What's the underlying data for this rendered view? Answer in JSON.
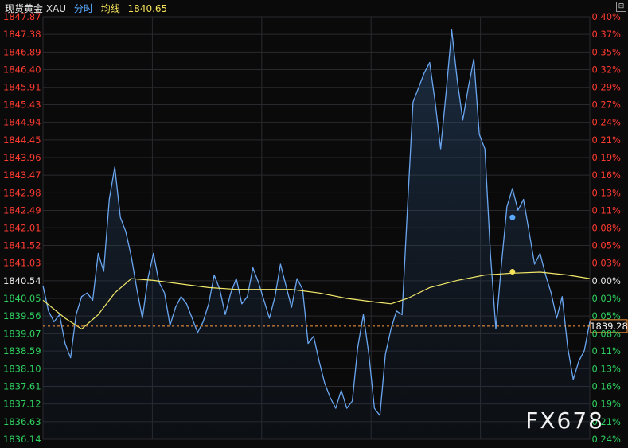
{
  "header": {
    "title": "现货黄金 XAU",
    "tab": "分时",
    "ma_label": "均线",
    "ma_value": "1840.65"
  },
  "corner_glyph": "⊟",
  "watermark": "FX678",
  "colors": {
    "up": "#ff3b30",
    "down": "#2fd05f",
    "neutral": "#e6e6e6",
    "price_line": "#6aa6f0",
    "avg_line": "#f2e86a",
    "grid": "#2a2a2e",
    "current_line": "#ff9a3c",
    "current_box_border": "#ff9a3c",
    "blue_dot": "#5aa9ff",
    "yellow_dot": "#f5e25a"
  },
  "chart_data": {
    "type": "line",
    "title": "",
    "xlabel": "",
    "ylabel": "",
    "ylim": [
      1836.14,
      1847.87
    ],
    "reference_price": 1840.54,
    "current_price": 1839.28,
    "current_price_label": "1839.28",
    "y_ticks": [
      {
        "price": "1847.87",
        "pct": "0.40%",
        "dir": "up"
      },
      {
        "price": "1847.38",
        "pct": "0.37%",
        "dir": "up"
      },
      {
        "price": "1846.89",
        "pct": "0.35%",
        "dir": "up"
      },
      {
        "price": "1846.40",
        "pct": "0.32%",
        "dir": "up"
      },
      {
        "price": "1845.91",
        "pct": "0.29%",
        "dir": "up"
      },
      {
        "price": "1845.43",
        "pct": "0.27%",
        "dir": "up"
      },
      {
        "price": "1844.94",
        "pct": "0.24%",
        "dir": "up"
      },
      {
        "price": "1844.45",
        "pct": "0.21%",
        "dir": "up"
      },
      {
        "price": "1843.96",
        "pct": "0.19%",
        "dir": "up"
      },
      {
        "price": "1843.47",
        "pct": "0.16%",
        "dir": "up"
      },
      {
        "price": "1842.98",
        "pct": "0.13%",
        "dir": "up"
      },
      {
        "price": "1842.49",
        "pct": "0.11%",
        "dir": "up"
      },
      {
        "price": "1842.01",
        "pct": "0.08%",
        "dir": "up"
      },
      {
        "price": "1841.52",
        "pct": "0.05%",
        "dir": "up"
      },
      {
        "price": "1841.03",
        "pct": "0.03%",
        "dir": "up"
      },
      {
        "price": "1840.54",
        "pct": "0.00%",
        "dir": "flat"
      },
      {
        "price": "1840.05",
        "pct": "0.03%",
        "dir": "down"
      },
      {
        "price": "1839.56",
        "pct": "0.05%",
        "dir": "down"
      },
      {
        "price": "1839.07",
        "pct": "0.08%",
        "dir": "down"
      },
      {
        "price": "1838.59",
        "pct": "0.11%",
        "dir": "down"
      },
      {
        "price": "1838.10",
        "pct": "0.13%",
        "dir": "down"
      },
      {
        "price": "1837.61",
        "pct": "0.16%",
        "dir": "down"
      },
      {
        "price": "1837.12",
        "pct": "0.19%",
        "dir": "down"
      },
      {
        "price": "1836.63",
        "pct": "0.21%",
        "dir": "down"
      },
      {
        "price": "1836.14",
        "pct": "0.24%",
        "dir": "down"
      }
    ],
    "x_count": 100,
    "price_points": [
      [
        0,
        1840.4
      ],
      [
        1,
        1839.7
      ],
      [
        2,
        1839.4
      ],
      [
        3,
        1839.6
      ],
      [
        4,
        1838.8
      ],
      [
        5,
        1838.4
      ],
      [
        6,
        1839.6
      ],
      [
        7,
        1840.1
      ],
      [
        8,
        1840.2
      ],
      [
        9,
        1840.0
      ],
      [
        10,
        1841.3
      ],
      [
        11,
        1840.8
      ],
      [
        12,
        1842.8
      ],
      [
        13,
        1843.7
      ],
      [
        14,
        1842.3
      ],
      [
        15,
        1841.9
      ],
      [
        16,
        1841.2
      ],
      [
        17,
        1840.3
      ],
      [
        18,
        1839.5
      ],
      [
        19,
        1840.6
      ],
      [
        20,
        1841.3
      ],
      [
        21,
        1840.5
      ],
      [
        22,
        1840.2
      ],
      [
        23,
        1839.3
      ],
      [
        24,
        1839.8
      ],
      [
        25,
        1840.1
      ],
      [
        26,
        1839.9
      ],
      [
        27,
        1839.5
      ],
      [
        28,
        1839.1
      ],
      [
        29,
        1839.4
      ],
      [
        30,
        1839.9
      ],
      [
        31,
        1840.7
      ],
      [
        32,
        1840.3
      ],
      [
        33,
        1839.6
      ],
      [
        34,
        1840.2
      ],
      [
        35,
        1840.6
      ],
      [
        36,
        1839.9
      ],
      [
        37,
        1840.1
      ],
      [
        38,
        1840.9
      ],
      [
        39,
        1840.5
      ],
      [
        40,
        1840.0
      ],
      [
        41,
        1839.5
      ],
      [
        42,
        1840.1
      ],
      [
        43,
        1841.0
      ],
      [
        44,
        1840.4
      ],
      [
        45,
        1839.8
      ],
      [
        46,
        1840.6
      ],
      [
        47,
        1840.3
      ],
      [
        48,
        1838.8
      ],
      [
        49,
        1839.0
      ],
      [
        50,
        1838.3
      ],
      [
        51,
        1837.7
      ],
      [
        52,
        1837.3
      ],
      [
        53,
        1837.0
      ],
      [
        54,
        1837.5
      ],
      [
        55,
        1837.0
      ],
      [
        56,
        1837.2
      ],
      [
        57,
        1838.7
      ],
      [
        58,
        1839.6
      ],
      [
        59,
        1838.5
      ],
      [
        60,
        1837.0
      ],
      [
        61,
        1836.8
      ],
      [
        62,
        1838.5
      ],
      [
        63,
        1839.2
      ],
      [
        64,
        1839.7
      ],
      [
        65,
        1839.6
      ],
      [
        66,
        1842.6
      ],
      [
        67,
        1845.5
      ],
      [
        68,
        1845.9
      ],
      [
        69,
        1846.3
      ],
      [
        70,
        1846.6
      ],
      [
        71,
        1845.5
      ],
      [
        72,
        1844.2
      ],
      [
        73,
        1845.8
      ],
      [
        74,
        1847.5
      ],
      [
        75,
        1846.1
      ],
      [
        76,
        1845.0
      ],
      [
        77,
        1845.9
      ],
      [
        78,
        1846.7
      ],
      [
        79,
        1844.6
      ],
      [
        80,
        1844.2
      ],
      [
        81,
        1841.3
      ],
      [
        82,
        1839.2
      ],
      [
        83,
        1841.0
      ],
      [
        84,
        1842.6
      ],
      [
        85,
        1843.1
      ],
      [
        86,
        1842.5
      ],
      [
        87,
        1842.8
      ],
      [
        88,
        1841.9
      ],
      [
        89,
        1841.0
      ],
      [
        90,
        1841.3
      ],
      [
        91,
        1840.7
      ],
      [
        92,
        1840.2
      ],
      [
        93,
        1839.5
      ],
      [
        94,
        1840.1
      ],
      [
        95,
        1838.7
      ],
      [
        96,
        1837.8
      ],
      [
        97,
        1838.3
      ],
      [
        98,
        1838.6
      ],
      [
        99,
        1839.4
      ]
    ],
    "avg_points": [
      [
        0,
        1840.0
      ],
      [
        4,
        1839.5
      ],
      [
        7,
        1839.2
      ],
      [
        10,
        1839.6
      ],
      [
        13,
        1840.2
      ],
      [
        16,
        1840.6
      ],
      [
        20,
        1840.55
      ],
      [
        25,
        1840.45
      ],
      [
        30,
        1840.35
      ],
      [
        35,
        1840.3
      ],
      [
        40,
        1840.3
      ],
      [
        45,
        1840.3
      ],
      [
        50,
        1840.2
      ],
      [
        55,
        1840.05
      ],
      [
        60,
        1839.95
      ],
      [
        63,
        1839.9
      ],
      [
        66,
        1840.05
      ],
      [
        70,
        1840.35
      ],
      [
        75,
        1840.55
      ],
      [
        80,
        1840.7
      ],
      [
        85,
        1840.75
      ],
      [
        90,
        1840.78
      ],
      [
        95,
        1840.7
      ],
      [
        99,
        1840.6
      ]
    ],
    "markers": [
      {
        "x": 85,
        "y": 1842.3,
        "kind": "blue"
      },
      {
        "x": 85,
        "y": 1840.79,
        "kind": "yellow"
      }
    ],
    "grid": true
  }
}
